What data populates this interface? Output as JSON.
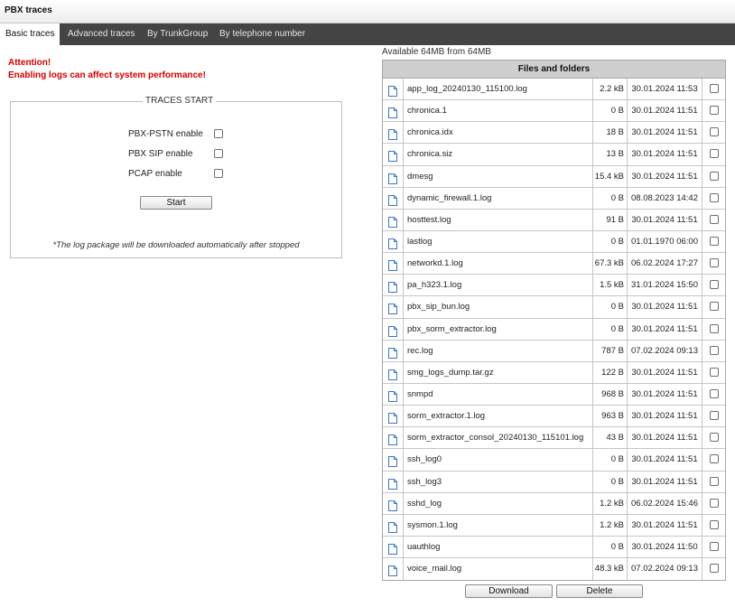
{
  "window": {
    "title": "PBX traces"
  },
  "tabs": [
    {
      "label": "Basic traces",
      "active": true
    },
    {
      "label": "Advanced traces",
      "active": false
    },
    {
      "label": "By TrunkGroup",
      "active": false
    },
    {
      "label": "By telephone number",
      "active": false
    }
  ],
  "attention": {
    "title": "Attention!",
    "message": "Enabling logs can affect system performance!",
    "color": "#d40000"
  },
  "traces_start": {
    "legend": "TRACES START",
    "options": [
      {
        "label": "PBX-PSTN enable",
        "checked": false
      },
      {
        "label": "PBX SIP enable",
        "checked": false
      },
      {
        "label": "PCAP enable",
        "checked": false
      }
    ],
    "start_label": "Start",
    "note": "*The log package will be downloaded automatically after stopped"
  },
  "files": {
    "available": "Available 64MB from 64MB",
    "header": "Files and folders",
    "icon": "file-icon",
    "rows": [
      {
        "name": "app_log_20240130_115100.log",
        "size": "2.2 kB",
        "date": "30.01.2024 11:53",
        "selected": false
      },
      {
        "name": "chronica.1",
        "size": "0 B",
        "date": "30.01.2024 11:51",
        "selected": false
      },
      {
        "name": "chronica.idx",
        "size": "18 B",
        "date": "30.01.2024 11:51",
        "selected": false
      },
      {
        "name": "chronica.siz",
        "size": "13 B",
        "date": "30.01.2024 11:51",
        "selected": false
      },
      {
        "name": "dmesg",
        "size": "15.4 kB",
        "date": "30.01.2024 11:51",
        "selected": false
      },
      {
        "name": "dynamic_firewall.1.log",
        "size": "0 B",
        "date": "08.08.2023 14:42",
        "selected": false
      },
      {
        "name": "hosttest.log",
        "size": "91 B",
        "date": "30.01.2024 11:51",
        "selected": false
      },
      {
        "name": "lastlog",
        "size": "0 B",
        "date": "01.01.1970 06:00",
        "selected": false
      },
      {
        "name": "networkd.1.log",
        "size": "67.3 kB",
        "date": "06.02.2024 17:27",
        "selected": false
      },
      {
        "name": "pa_h323.1.log",
        "size": "1.5 kB",
        "date": "31.01.2024 15:50",
        "selected": false
      },
      {
        "name": "pbx_sip_bun.log",
        "size": "0 B",
        "date": "30.01.2024 11:51",
        "selected": false
      },
      {
        "name": "pbx_sorm_extractor.log",
        "size": "0 B",
        "date": "30.01.2024 11:51",
        "selected": false
      },
      {
        "name": "rec.log",
        "size": "787 B",
        "date": "07.02.2024 09:13",
        "selected": false
      },
      {
        "name": "smg_logs_dump.tar.gz",
        "size": "122 B",
        "date": "30.01.2024 11:51",
        "selected": false
      },
      {
        "name": "snmpd",
        "size": "968 B",
        "date": "30.01.2024 11:51",
        "selected": false
      },
      {
        "name": "sorm_extractor.1.log",
        "size": "963 B",
        "date": "30.01.2024 11:51",
        "selected": false
      },
      {
        "name": "sorm_extractor_consol_20240130_115101.log",
        "size": "43 B",
        "date": "30.01.2024 11:51",
        "selected": false
      },
      {
        "name": "ssh_log0",
        "size": "0 B",
        "date": "30.01.2024 11:51",
        "selected": false
      },
      {
        "name": "ssh_log3",
        "size": "0 B",
        "date": "30.01.2024 11:51",
        "selected": false
      },
      {
        "name": "sshd_log",
        "size": "1.2 kB",
        "date": "06.02.2024 15:46",
        "selected": false
      },
      {
        "name": "sysmon.1.log",
        "size": "1.2 kB",
        "date": "30.01.2024 11:51",
        "selected": false
      },
      {
        "name": "uauthlog",
        "size": "0 B",
        "date": "30.01.2024 11:50",
        "selected": false
      },
      {
        "name": "voice_mail.log",
        "size": "48.3 kB",
        "date": "07.02.2024 09:13",
        "selected": false
      }
    ],
    "download_label": "Download",
    "delete_label": "Delete"
  }
}
